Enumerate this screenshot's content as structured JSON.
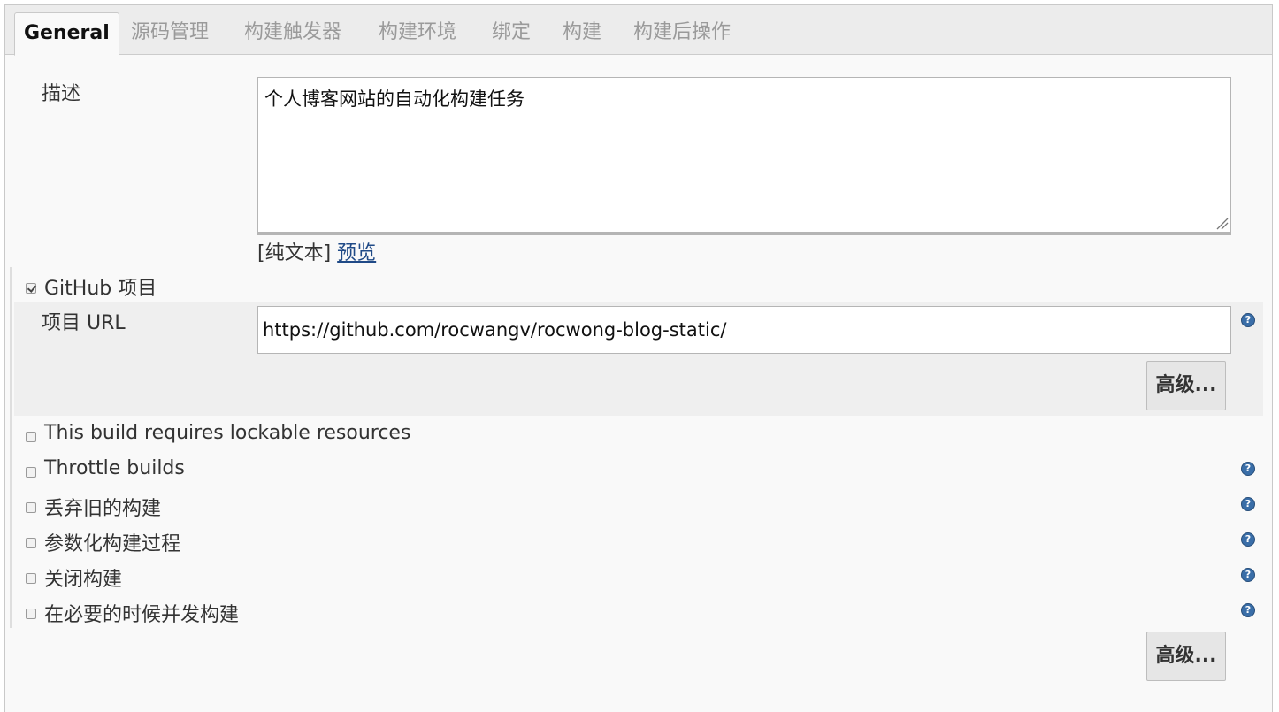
{
  "tabs": [
    {
      "label": "General",
      "active": true
    },
    {
      "label": "源码管理"
    },
    {
      "label": "构建触发器"
    },
    {
      "label": "构建环境"
    },
    {
      "label": "绑定"
    },
    {
      "label": "构建"
    },
    {
      "label": "构建后操作"
    }
  ],
  "description": {
    "label": "描述",
    "value": "个人博客网站的自动化构建任务",
    "plain_text": "[纯文本]",
    "preview_link": "预览"
  },
  "github_project": {
    "label": "GitHub 项目",
    "checked": true,
    "url_label": "项目 URL",
    "url_value": "https://github.com/rocwangv/rocwong-blog-static/",
    "advanced_button": "高级..."
  },
  "options": [
    {
      "label": "This build requires lockable resources",
      "checked": false
    },
    {
      "label": "Throttle builds",
      "checked": false
    },
    {
      "label": "丢弃旧的构建",
      "checked": false
    },
    {
      "label": "参数化构建过程",
      "checked": false
    },
    {
      "label": "关闭构建",
      "checked": false
    },
    {
      "label": "在必要的时候并发构建",
      "checked": false
    }
  ],
  "advanced_button": "高级...",
  "help_icon": "?",
  "colors": {
    "link": "#204a87",
    "help_icon": "#3a6ea8",
    "tab_bar": "#ececec"
  }
}
